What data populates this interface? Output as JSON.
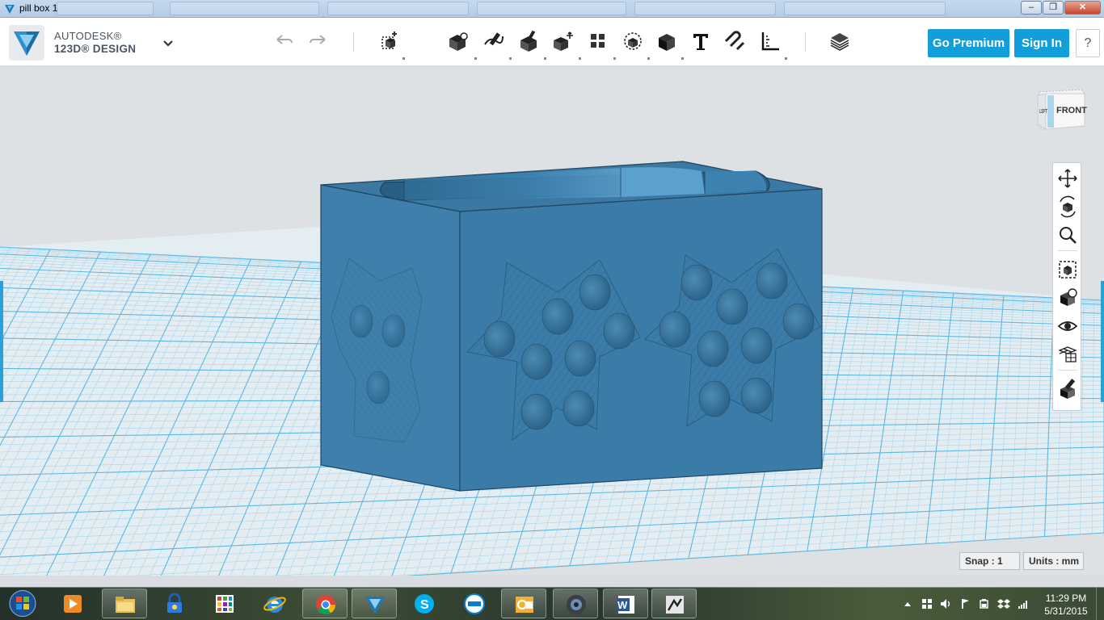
{
  "window": {
    "title": "pill box 1",
    "minimize": "–",
    "maximize": "❐",
    "close": "✕"
  },
  "brand": {
    "name": "AUTODESK®",
    "product": "123D® DESIGN"
  },
  "toolbar": {
    "tools": [
      "undo-icon",
      "redo-icon",
      "primitives-icon",
      "sketch-icon",
      "construct-icon",
      "modify-icon",
      "pattern-icon",
      "grouping-icon",
      "combine-icon",
      "measure-icon",
      "text-icon",
      "snap-icon",
      "material-icon",
      "layers-icon"
    ],
    "go_premium_label": "Go Premium",
    "sign_in_label": "Sign In",
    "help_label": "?"
  },
  "viewcube": {
    "front_label": "FRONT",
    "left_label": "LEFT"
  },
  "navbar": {
    "tools": [
      "pan-icon",
      "orbit-icon",
      "zoom-icon",
      "fit-icon",
      "view-mode-icon",
      "visibility-icon",
      "grid-icon",
      "material-icon"
    ]
  },
  "status": {
    "snap_label": "Snap : 1",
    "units_label": "Units : mm"
  },
  "taskbar": {
    "apps": [
      "file-explorer",
      "security-lock",
      "apps-grid",
      "internet-explorer",
      "chrome",
      "123d-design",
      "skype",
      "dell",
      "outlook",
      "camera",
      "word",
      "workbench"
    ],
    "time": "11:29 PM",
    "date": "5/31/2015"
  },
  "colors": {
    "accent": "#129fd9",
    "model": "#3b7ca8",
    "grid": "#7fc7e8",
    "viewport_bg": "#dee1e4"
  }
}
